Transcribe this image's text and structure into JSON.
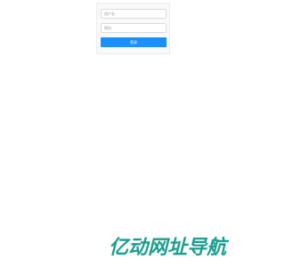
{
  "login_form": {
    "username_placeholder": "用户名",
    "password_placeholder": "密码",
    "submit_label": "登录"
  },
  "watermark": {
    "text": "亿动网址导航"
  },
  "colors": {
    "button": "#1890ff",
    "watermark": "#1a9e8f"
  }
}
